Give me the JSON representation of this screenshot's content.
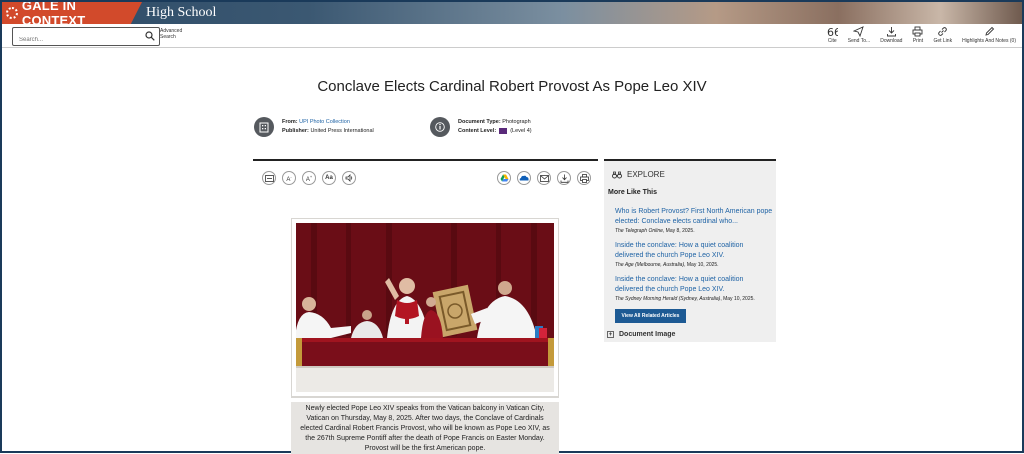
{
  "brand": {
    "name": "GALE IN CONTEXT",
    "level": "High School"
  },
  "search": {
    "placeholder": "Search...",
    "advanced_label": "Advanced Search"
  },
  "tools": [
    {
      "label": "Cite",
      "icon": "quote-icon"
    },
    {
      "label": "Send To...",
      "icon": "send-icon"
    },
    {
      "label": "Download",
      "icon": "download-icon"
    },
    {
      "label": "Print",
      "icon": "print-icon"
    },
    {
      "label": "Get Link",
      "icon": "link-icon"
    },
    {
      "label": "Highlights And Notes (0)",
      "icon": "pencil-icon"
    }
  ],
  "document": {
    "title": "Conclave Elects Cardinal Robert Provost As Pope Leo XIV",
    "from_label": "From:",
    "from_value": "UPI Photo Collection",
    "publisher_label": "Publisher:",
    "publisher_value": "United Press International",
    "type_label": "Document Type:",
    "type_value": "Photograph",
    "content_label": "Content Level:",
    "content_value": "(Level 4)"
  },
  "reader_tools": [
    "translate-icon",
    "decrease-text-icon",
    "increase-text-icon",
    "font-icon",
    "listen-icon"
  ],
  "share_tools": [
    "google-drive-icon",
    "onedrive-icon",
    "email-icon",
    "download-icon",
    "print-icon"
  ],
  "image": {
    "caption": "Newly elected Pope Leo XIV speaks from the Vatican balcony in Vatican City, Vatican on Thursday, May 8, 2025. After two days, the Conclave of Cardinals elected Cardinal Robert Francis Provost, who will be known as Pope Leo XIV, as the 267th Supreme Pontiff after the death of Pope Francis on Easter Monday. Provost will be the first American pope."
  },
  "explore": {
    "heading": "EXPLORE",
    "more_like_this": "More Like This",
    "related": [
      {
        "title": "Who is Robert Provost? First North American pope elected: Conclave elects cardinal who...",
        "source": "The Telegraph Online",
        "date": ", May 8, 2025."
      },
      {
        "title": "Inside the conclave: How a quiet coalition delivered the church Pope Leo XIV.",
        "source": "The Age (Melbourne, Australia)",
        "date": ", May 10, 2025."
      },
      {
        "title": "Inside the conclave: How a quiet coalition delivered the church Pope Leo XIV.",
        "source": "The Sydney Morning Herald (Sydney, Australia)",
        "date": ", May 10, 2025."
      }
    ],
    "view_all": "View All Related Articles",
    "document_image": "Document Image"
  },
  "colors": {
    "brand_red": "#d24a2b",
    "link_blue": "#1f63a5",
    "button_blue": "#1d5a94"
  }
}
